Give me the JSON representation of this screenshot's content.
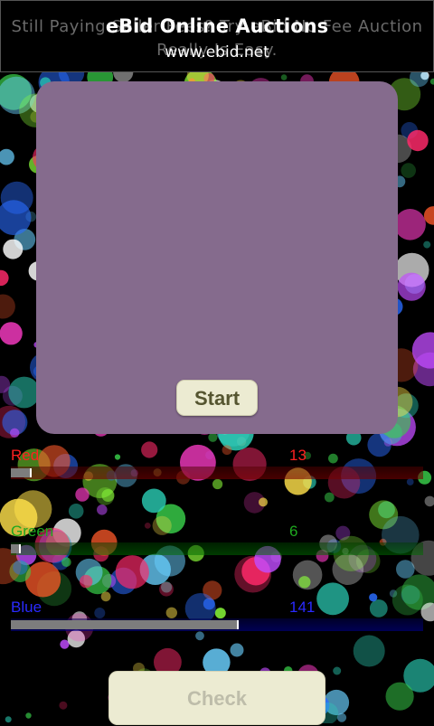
{
  "ad": {
    "scrolling_text": "Still Paying Seller Fees? Try eBid No Fee Auction Really Is Easy.",
    "title": "eBid Online Auctions",
    "url": "www.ebid.net"
  },
  "preview": {
    "color": "#856b8d"
  },
  "buttons": {
    "start_label": "Start",
    "check_label": "Check"
  },
  "sliders": {
    "red": {
      "label": "Red",
      "value": "13",
      "value_num": 13,
      "max": 255,
      "color": "#ff2020"
    },
    "green": {
      "label": "Green",
      "value": "6",
      "value_num": 6,
      "max": 255,
      "color": "#1fa81f"
    },
    "blue": {
      "label": "Blue",
      "value": "141",
      "value_num": 141,
      "max": 255,
      "color": "#2a2aff"
    }
  }
}
